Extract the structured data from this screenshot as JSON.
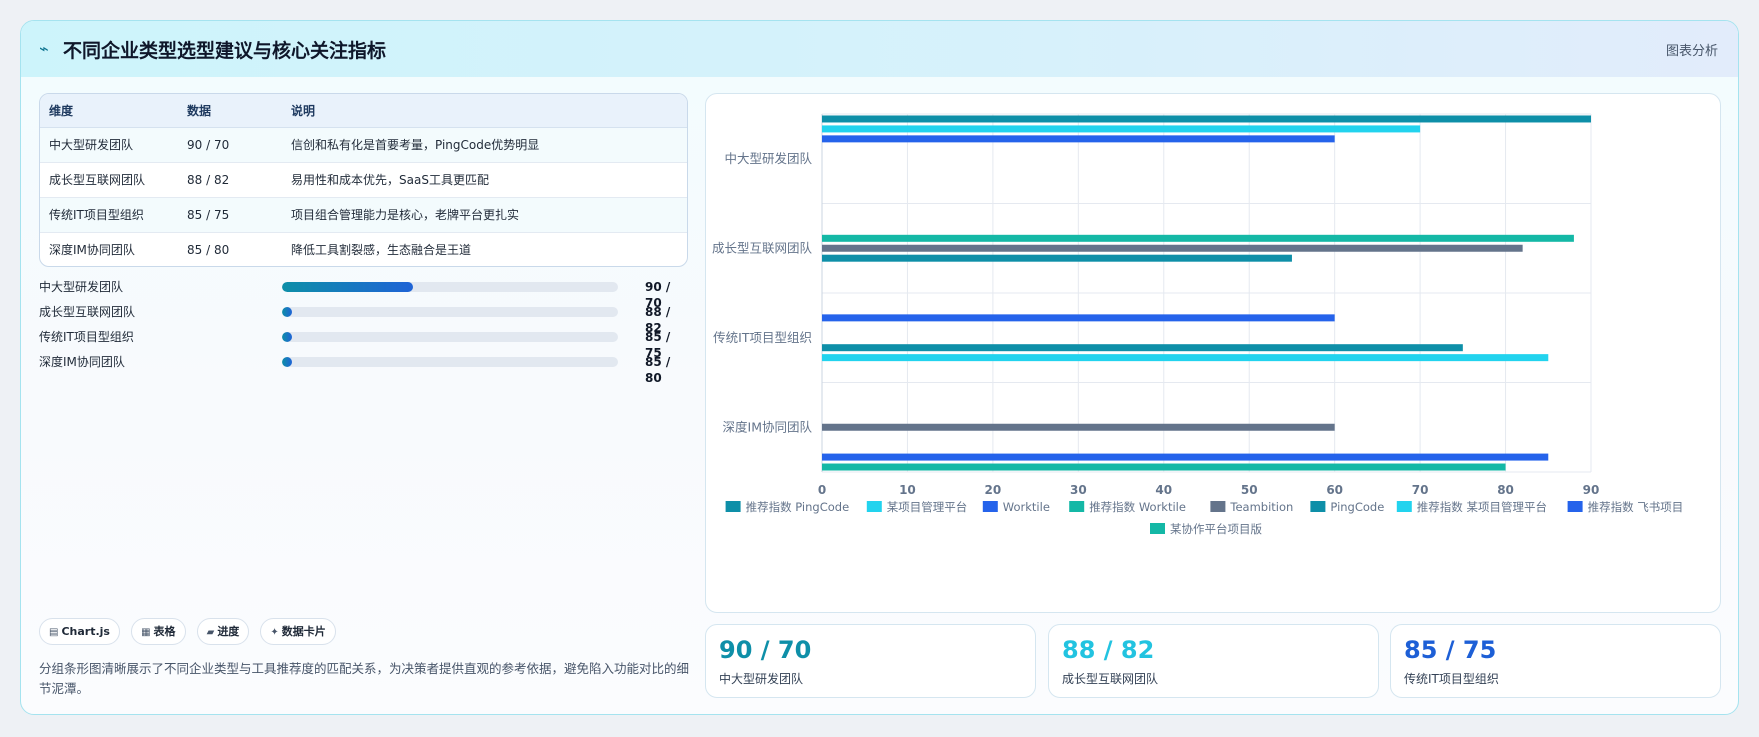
{
  "header": {
    "icon": "trend-icon",
    "title": "不同企业类型选型建议与核心关注指标",
    "tag": "图表分析"
  },
  "table": {
    "headers": [
      "维度",
      "数据",
      "说明"
    ],
    "rows": [
      [
        "中大型研发团队",
        "90 / 70",
        "信创和私有化是首要考量，PingCode优势明显"
      ],
      [
        "成长型互联网团队",
        "88 / 82",
        "易用性和成本优先，SaaS工具更匹配"
      ],
      [
        "传统IT项目型组织",
        "85 / 75",
        "项目组合管理能力是核心，老牌平台更扎实"
      ],
      [
        "深度IM协同团队",
        "85 / 80",
        "降低工具割裂感，生态融合是王道"
      ]
    ]
  },
  "progress": [
    {
      "label": "中大型研发团队",
      "value_text": "90 / 70",
      "fill_fraction": 0.39
    },
    {
      "label": "成长型互联网团队",
      "value_text": "88 / 82",
      "fill_fraction": 0.0
    },
    {
      "label": "传统IT项目型组织",
      "value_text": "85 / 75",
      "fill_fraction": 0.0
    },
    {
      "label": "深度IM协同团队",
      "value_text": "85 / 80",
      "fill_fraction": 0.0
    }
  ],
  "chips": [
    {
      "icon": "▤",
      "label": "Chart.js"
    },
    {
      "icon": "▦",
      "label": "表格"
    },
    {
      "icon": "▰",
      "label": "进度"
    },
    {
      "icon": "✦",
      "label": "数据卡片"
    }
  ],
  "description": "分组条形图清晰展示了不同企业类型与工具推荐度的匹配关系，为决策者提供直观的参考依据，避免陷入功能对比的细节泥潭。",
  "chart_data": {
    "type": "bar",
    "orientation": "horizontal",
    "categories": [
      "中大型研发团队",
      "成长型互联网团队",
      "传统IT项目型组织",
      "深度IM协同团队"
    ],
    "xlim": [
      0,
      90
    ],
    "xticks": [
      0,
      10,
      20,
      30,
      40,
      50,
      60,
      70,
      80,
      90
    ],
    "grid": true,
    "legend_position": "bottom",
    "series": [
      {
        "name": "推荐指数 PingCode",
        "color": "#0e8fa8",
        "values": [
          90,
          null,
          null,
          null
        ]
      },
      {
        "name": "某项目管理平台",
        "color": "#22d3ee",
        "values": [
          70,
          null,
          null,
          null
        ]
      },
      {
        "name": "Worktile",
        "color": "#2563eb",
        "values": [
          60,
          null,
          null,
          null
        ]
      },
      {
        "name": "推荐指数 Worktile",
        "color": "#14b8a6",
        "values": [
          null,
          88,
          null,
          null
        ]
      },
      {
        "name": "Teambition",
        "color": "#64748b",
        "values": [
          null,
          82,
          null,
          null
        ]
      },
      {
        "name": "PingCode",
        "color": "#0e8fa8",
        "values": [
          null,
          55,
          null,
          null
        ]
      },
      {
        "name": "推荐指数 某项目管理平台",
        "color": "#22d3ee",
        "values": [
          null,
          null,
          null,
          null
        ]
      },
      {
        "name": "推荐指数 飞书项目",
        "color": "#2563eb",
        "values": [
          null,
          null,
          null,
          null
        ]
      },
      {
        "name": "某协作平台项目版",
        "color": "#14b8a6",
        "values": [
          null,
          null,
          null,
          null
        ]
      }
    ],
    "bars": [
      {
        "category": 0,
        "slot": 0,
        "value": 90,
        "color": "#0e8fa8"
      },
      {
        "category": 0,
        "slot": 1,
        "value": 70,
        "color": "#22d3ee"
      },
      {
        "category": 0,
        "slot": 2,
        "value": 60,
        "color": "#2563eb"
      },
      {
        "category": 1,
        "slot": 3,
        "value": 88,
        "color": "#14b8a6"
      },
      {
        "category": 1,
        "slot": 4,
        "value": 82,
        "color": "#64748b"
      },
      {
        "category": 1,
        "slot": 5,
        "value": 55,
        "color": "#0e8fa8"
      },
      {
        "category": 2,
        "slot": 2,
        "value": 60,
        "color": "#2563eb"
      },
      {
        "category": 2,
        "slot": 5,
        "value": 75,
        "color": "#0e8fa8"
      },
      {
        "category": 2,
        "slot": 6,
        "value": 85,
        "color": "#22d3ee"
      },
      {
        "category": 3,
        "slot": 4,
        "value": 60,
        "color": "#64748b"
      },
      {
        "category": 3,
        "slot": 7,
        "value": 85,
        "color": "#2563eb"
      },
      {
        "category": 3,
        "slot": 8,
        "value": 80,
        "color": "#14b8a6"
      }
    ]
  },
  "stats": [
    {
      "value": "90 / 70",
      "label": "中大型研发团队",
      "color": "#0e8fa8"
    },
    {
      "value": "88 / 82",
      "label": "成长型互联网团队",
      "color": "#22c3e0"
    },
    {
      "value": "85 / 75",
      "label": "传统IT项目型组织",
      "color": "#1d5fd6"
    }
  ]
}
